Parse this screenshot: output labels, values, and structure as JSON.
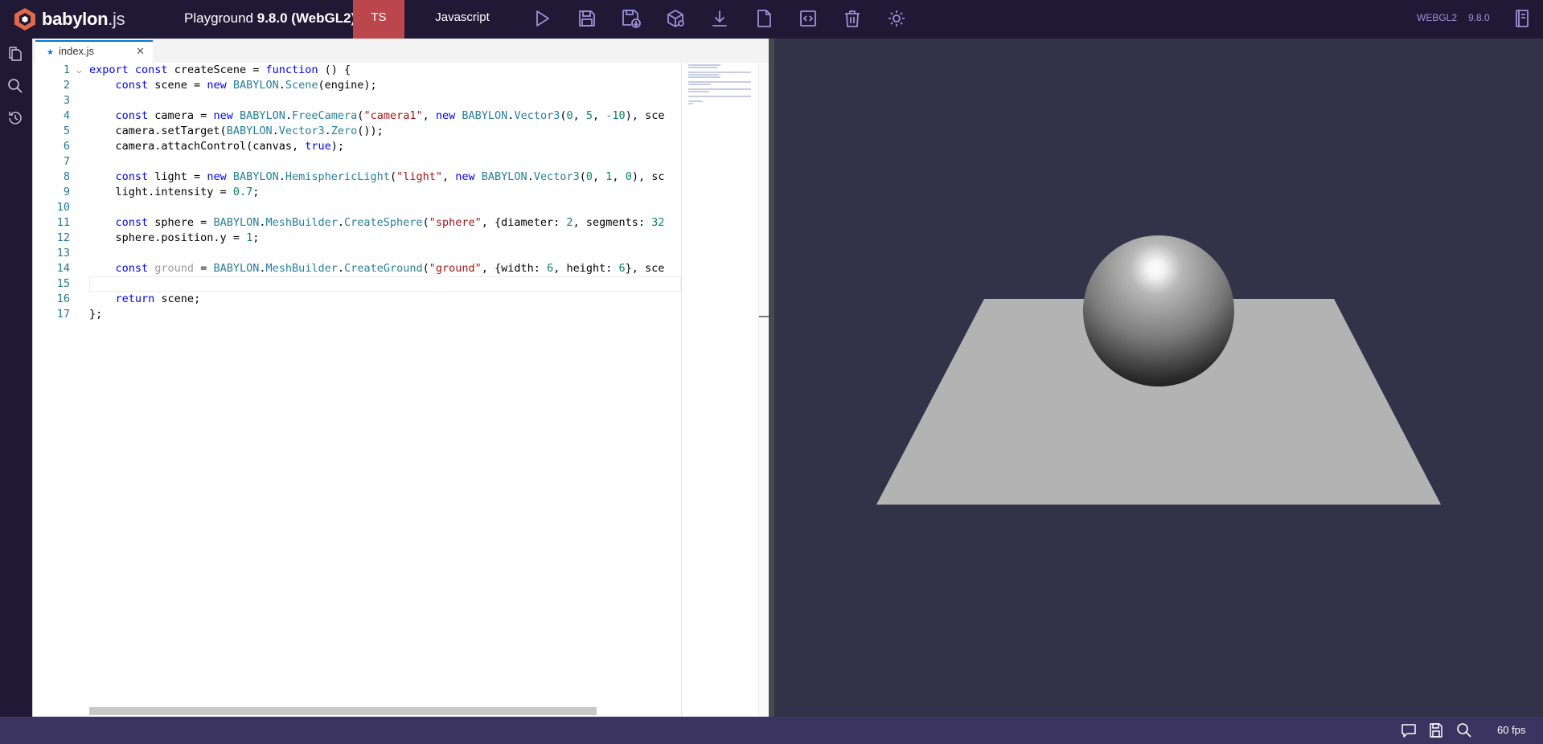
{
  "header": {
    "logo_main": "babylon",
    "logo_ext": ".js",
    "playground_label": "Playground",
    "playground_version": "9.8.0 (WebGL2)",
    "ts_label": "TS",
    "js_label": "Javascript",
    "engine_label": "WEBGL2",
    "version_label": "9.8.0"
  },
  "editor": {
    "tab_name": "index.js",
    "line_numbers": [
      "1",
      "2",
      "3",
      "4",
      "5",
      "6",
      "7",
      "8",
      "9",
      "10",
      "11",
      "12",
      "13",
      "14",
      "15",
      "16",
      "17"
    ]
  },
  "code": {
    "l1": {
      "a": "export",
      "b": "const",
      "c": "createScene = ",
      "d": "function",
      "e": " () {"
    },
    "l2": {
      "a": "const",
      "b": " scene = ",
      "c": "new",
      "d": "BABYLON",
      "e": ".",
      "f": "Scene",
      "g": "(engine);"
    },
    "l4": {
      "a": "const",
      "b": " camera = ",
      "c": "new",
      "d": "BABYLON",
      "e": ".",
      "f": "FreeCamera",
      "g": "(",
      "h": "\"camera1\"",
      "i": ", ",
      "j": "new",
      "k": "BABYLON",
      "l": ".",
      "m": "Vector3",
      "n": "(",
      "o": "0",
      "p": ", ",
      "q": "5",
      "r": ", ",
      "s": "-10",
      "t": "), sce"
    },
    "l5": {
      "a": "camera.setTarget(",
      "b": "BABYLON",
      "c": ".",
      "d": "Vector3",
      "e": ".",
      "f": "Zero",
      "g": "());"
    },
    "l6": {
      "a": "camera.attachControl(canvas, ",
      "b": "true",
      "c": ");"
    },
    "l8": {
      "a": "const",
      "b": " light = ",
      "c": "new",
      "d": "BABYLON",
      "e": ".",
      "f": "HemisphericLight",
      "g": "(",
      "h": "\"light\"",
      "i": ", ",
      "j": "new",
      "k": "BABYLON",
      "l": ".",
      "m": "Vector3",
      "n": "(",
      "o": "0",
      "p": ", ",
      "q": "1",
      "r": ", ",
      "s": "0",
      "t": "), sc"
    },
    "l9": {
      "a": "light.intensity = ",
      "b": "0.7",
      "c": ";"
    },
    "l11": {
      "a": "const",
      "b": " sphere = ",
      "c": "BABYLON",
      "d": ".",
      "e": "MeshBuilder",
      "f": ".",
      "g": "CreateSphere",
      "h": "(",
      "i": "\"sphere\"",
      "j": ", {diameter: ",
      "k": "2",
      "l": ", segments: ",
      "m": "32"
    },
    "l12": {
      "a": "sphere.position.y = ",
      "b": "1",
      "c": ";"
    },
    "l14": {
      "a": "const",
      "b": " ",
      "c": "ground",
      "d": " = ",
      "e": "BABYLON",
      "f": ".",
      "g": "MeshBuilder",
      "h": ".",
      "i": "CreateGround",
      "j": "(",
      "k": "\"ground\"",
      "l": ", {width: ",
      "m": "6",
      "n": ", height: ",
      "o": "6",
      "p": "}, sce"
    },
    "l16": {
      "a": "return",
      "b": " scene;"
    },
    "l17": {
      "a": "};"
    }
  },
  "status": {
    "fps": "60 fps"
  },
  "icons": {
    "run": "play-icon",
    "save": "save-icon",
    "save_as": "save-as-icon",
    "inspector": "cube-icon",
    "download": "download-icon",
    "new": "new-file-icon",
    "format": "code-icon",
    "clear": "trash-icon",
    "settings": "gear-icon"
  },
  "colors": {
    "accent_ts": "#bb464b",
    "topbar": "#201936",
    "viewport": "#333249",
    "ground": "#b3b3b3"
  }
}
